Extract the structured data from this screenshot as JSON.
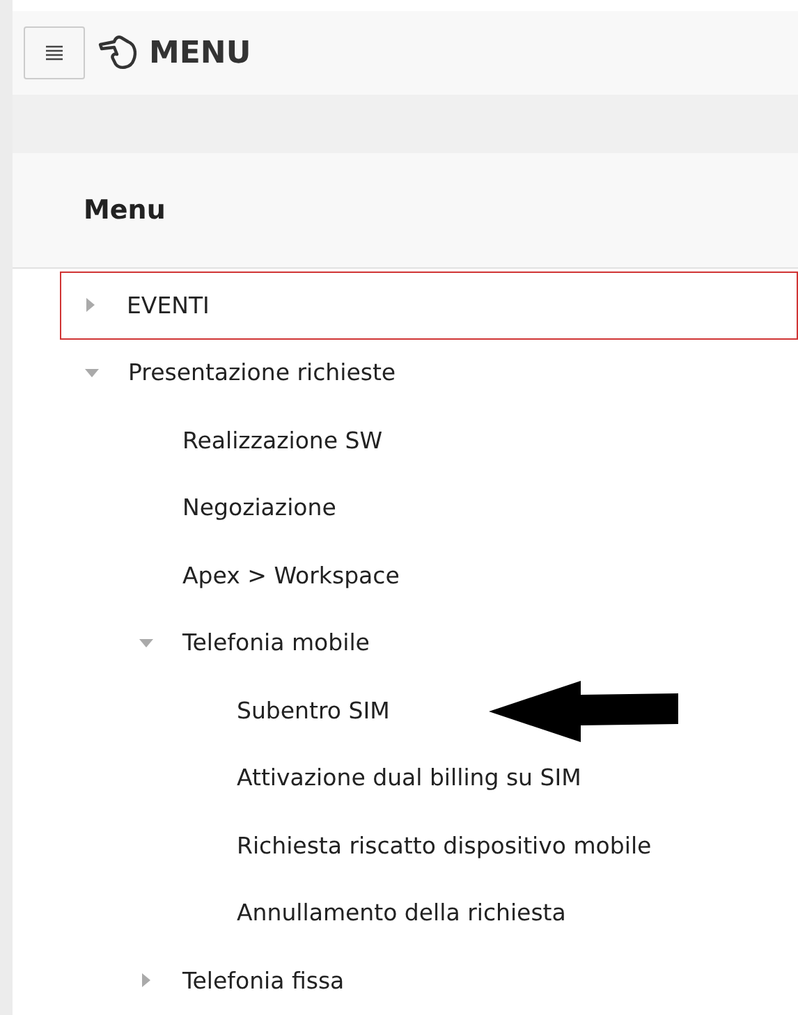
{
  "header": {
    "title": "MENU"
  },
  "menu": {
    "title": "Menu",
    "items": [
      {
        "label": "EVENTI",
        "expanded": false,
        "focused": true,
        "marked": false
      },
      {
        "label": "Presentazione richieste",
        "expanded": true,
        "focused": false,
        "marked": false,
        "children": [
          {
            "label": "Realizzazione SW",
            "focused": false,
            "marked": false
          },
          {
            "label": "Negoziazione",
            "focused": false,
            "marked": false
          },
          {
            "label": "Apex > Workspace",
            "focused": false,
            "marked": false
          },
          {
            "label": "Telefonia mobile",
            "expanded": true,
            "focused": false,
            "marked": false,
            "children": [
              {
                "label": "Subentro SIM",
                "focused": false,
                "marked": true
              },
              {
                "label": "Attivazione dual billing su SIM",
                "focused": false,
                "marked": false
              },
              {
                "label": "Richiesta riscatto dispositivo mobile",
                "focused": false,
                "marked": false
              },
              {
                "label": "Annullamento della richiesta",
                "focused": false,
                "marked": false
              }
            ]
          },
          {
            "label": "Telefonia fissa",
            "expanded": false,
            "focused": false,
            "marked": false
          }
        ]
      }
    ]
  }
}
